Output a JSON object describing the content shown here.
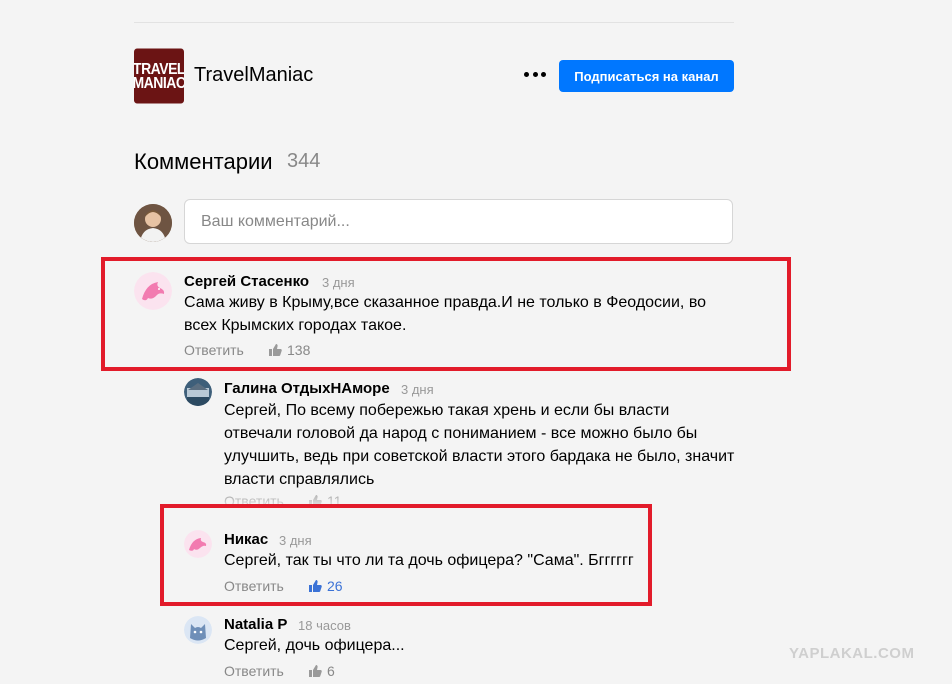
{
  "channel": {
    "logo_text": [
      "TRAVEL",
      "MANIAC"
    ],
    "name": "TravelManiac",
    "subscribe_label": "Подписаться на канал"
  },
  "comments_section": {
    "title": "Комментарии",
    "count": "344",
    "input_placeholder": "Ваш комментарий..."
  },
  "comments": [
    {
      "author": "Сергей Стасенко",
      "time": "3 дня",
      "lines": [
        "Сама живу в Крыму,все сказанное правда.И не только в Феодосии, во",
        "всех Крымских городах такое."
      ],
      "reply_label": "Ответить",
      "likes": "138"
    },
    {
      "author": "Галина ОтдыхНАморе",
      "time": "3 дня",
      "lines": [
        "Сергей, По всему побережью такая хрень и если бы власти",
        "отвечали головой да народ с пониманием - все можно было бы",
        "улучшить, ведь при советской власти этого бардака не было, значит",
        "власти справлялись"
      ],
      "reply_label": "Ответить",
      "likes": "11"
    },
    {
      "author": "Никас",
      "time": "3 дня",
      "lines": [
        "Сергей, так ты что ли та дочь офицера? \"Сама\". Бгггггг"
      ],
      "reply_label": "Ответить",
      "likes": "26"
    },
    {
      "author": "Natalia P",
      "time": "18 часов",
      "lines": [
        "Сергей, дочь офицера..."
      ],
      "reply_label": "Ответить",
      "likes": "6"
    }
  ],
  "watermark": "YAPLAKAL.COM",
  "colors": {
    "accent": "#0077ff",
    "highlight_box": "#e21b2a",
    "like_active": "#3b72d6",
    "avatar_pink": "#f7a8cc"
  }
}
